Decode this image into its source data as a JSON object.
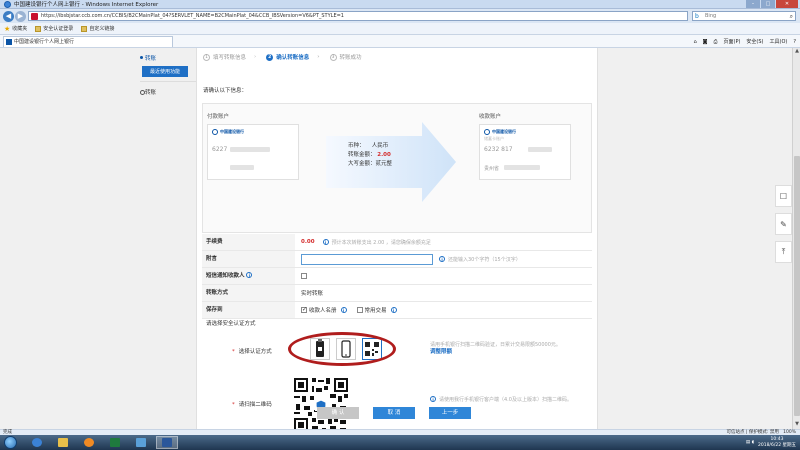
{
  "browser": {
    "window_title": "中国建设银行个人网上银行 - Windows Internet Explorer",
    "url": "https://ibsbjstar.ccb.com.cn/CCBIS/B2CMainPlat_04?SERVLET_NAME=B2CMainPlat_04&CCB_IBSVersion=V6&PT_STYLE=1",
    "search_placeholder": "Bing",
    "favorites_label": "收藏夹",
    "favorites": [
      "安全认证登录",
      "自定义链接"
    ],
    "tab_title": "中国建设银行个人网上银行",
    "commands": [
      "页面(P)",
      "安全(S)",
      "工具(O)"
    ]
  },
  "leftnav": {
    "item1": "转账",
    "item1_sub": "最近使用功能",
    "item2": "转账"
  },
  "steps": [
    {
      "num": "1",
      "label": "填写转账信息"
    },
    {
      "num": "2",
      "label": "确认转账信息"
    },
    {
      "num": "3",
      "label": "转账成功"
    }
  ],
  "confirm_text": "请确认以下信息：",
  "payer": {
    "title": "付款账户",
    "bank": "中国建设银行",
    "acct_prefix": "6227"
  },
  "payee": {
    "title": "收款账户",
    "bank": "中国建设银行",
    "sub": "储蓄卡账户",
    "acct_prefix": "6232 817",
    "branch": "贵州省"
  },
  "transfer": {
    "currency_label": "币种：",
    "currency": "人民币",
    "amount_label": "转账金额：",
    "amount": "2.00",
    "upper_label": "大写金额：",
    "upper": "贰元整"
  },
  "form": {
    "fee_label": "手续费",
    "fee_value": "0.00",
    "fee_hint": "预计本次转账支出 2.00 ，请您确保余额充足",
    "memo_label": "附言",
    "memo_hint": "还能输入30个字符（15个汉字）",
    "sms_label": "短信通知收款人",
    "method_label": "转账方式",
    "method_value": "实时转账",
    "save_label": "保存到",
    "save_opt1": "收款人名册",
    "save_opt2": "常用交易"
  },
  "auth": {
    "header": "请选择安全认证方式",
    "method_label": "选择认证方式",
    "method_hint": "请用手机银行扫描二维码验证，日累计交易限额50000元。",
    "limit_link": "调整限额",
    "qr_label": "请扫描二维码",
    "qr_hint": "请使用我行手机银行客户端（4.0及以上版本）扫描二维码。"
  },
  "buttons": {
    "confirm": "确 认",
    "cancel": "取 消",
    "prev": "上一步"
  },
  "status": {
    "left": "完成",
    "zone": "可信站点 | 保护模式: 禁用",
    "zoom": "100%"
  },
  "taskbar": {
    "time": "10:43",
    "date": "2018/6/22 星期五"
  },
  "colors": {
    "brand_blue": "#1e6fc5",
    "alert_red": "#d42b2b",
    "annotation_red": "#b01d1d"
  }
}
